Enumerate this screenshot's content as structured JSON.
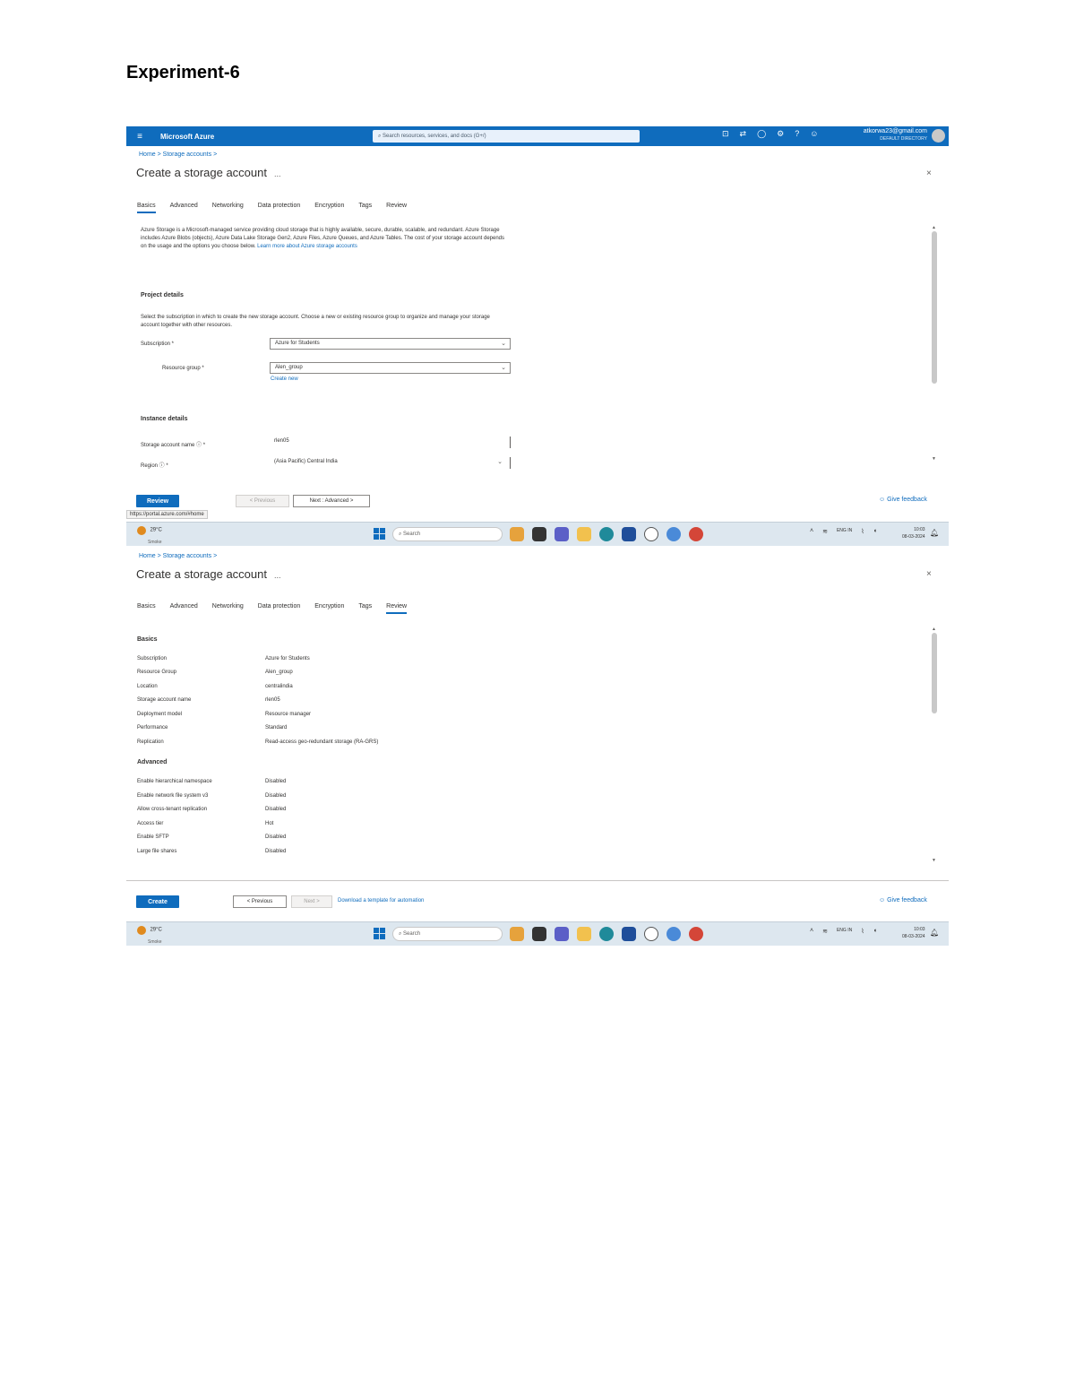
{
  "doc": {
    "title": "Experiment-6"
  },
  "azure": {
    "brand": "Microsoft Azure",
    "menu_icon": "hamburger-icon",
    "search_placeholder": "Search resources, services, and docs (G+/)",
    "user_email": "atkorwa23@gmail.com",
    "user_directory": "DEFAULT DIRECTORY"
  },
  "shot1": {
    "breadcrumb": "Home > Storage accounts >",
    "title": "Create a storage account",
    "more": "...",
    "close": "×",
    "tabs": [
      "Basics",
      "Advanced",
      "Networking",
      "Data protection",
      "Encryption",
      "Tags",
      "Review"
    ],
    "active_tab": "Basics",
    "intro_text": "Azure Storage is a Microsoft-managed service providing cloud storage that is highly available, secure, durable, scalable, and redundant. Azure Storage includes Azure Blobs (objects), Azure Data Lake Storage Gen2, Azure Files, Azure Queues, and Azure Tables. The cost of your storage account depends on the usage and the options you choose below.",
    "intro_link": "Learn more about Azure storage accounts",
    "project_heading": "Project details",
    "project_desc": "Select the subscription in which to create the new storage account. Choose a new or existing resource group to organize and manage your storage account together with other resources.",
    "subscription_label": "Subscription *",
    "subscription_value": "Azure for Students",
    "rg_label": "Resource group *",
    "rg_value": "Alen_group",
    "create_new": "Create new",
    "instance_heading": "Instance details",
    "sa_name_label": "Storage account name ⓘ *",
    "sa_name_value": "rlen05",
    "region_label": "Region ⓘ *",
    "region_value": "(Asia Pacific) Central India",
    "review_btn": "Review",
    "previous_btn": "< Previous",
    "next_btn": "Next : Advanced >",
    "feedback": "Give feedback",
    "status_url": "https://portal.azure.com/#home"
  },
  "shot2": {
    "breadcrumb": "Home > Storage accounts >",
    "title": "Create a storage account",
    "more": "...",
    "close": "×",
    "tabs": [
      "Basics",
      "Advanced",
      "Networking",
      "Data protection",
      "Encryption",
      "Tags",
      "Review"
    ],
    "active_tab": "Review",
    "basics_heading": "Basics",
    "basics": [
      {
        "label": "Subscription",
        "value": "Azure for Students"
      },
      {
        "label": "Resource Group",
        "value": "Alen_group"
      },
      {
        "label": "Location",
        "value": "centralindia"
      },
      {
        "label": "Storage account name",
        "value": "rlen05"
      },
      {
        "label": "Deployment model",
        "value": "Resource manager"
      },
      {
        "label": "Performance",
        "value": "Standard"
      },
      {
        "label": "Replication",
        "value": "Read-access geo-redundant storage (RA-GRS)"
      }
    ],
    "advanced_heading": "Advanced",
    "advanced": [
      {
        "label": "Enable hierarchical namespace",
        "value": "Disabled"
      },
      {
        "label": "Enable network file system v3",
        "value": "Disabled"
      },
      {
        "label": "Allow cross-tenant replication",
        "value": "Disabled"
      },
      {
        "label": "Access tier",
        "value": "Hot"
      },
      {
        "label": "Enable SFTP",
        "value": "Disabled"
      },
      {
        "label": "Large file shares",
        "value": "Disabled"
      }
    ],
    "create_btn": "Create",
    "previous_btn": "< Previous",
    "next_btn": "Next >",
    "download_link": "Download a template for automation",
    "feedback": "Give feedback"
  },
  "taskbar": {
    "temp": "29°C",
    "condition": "Smoke",
    "search_placeholder": "Search",
    "time": "10:03",
    "date": "08-03-2024",
    "lang": "ENG IN",
    "apps": [
      "copilot-icon",
      "file-explorer-icon",
      "teams-icon",
      "folder-icon",
      "edge-icon",
      "store-icon",
      "xbox-icon",
      "chrome-icon",
      "chrome-profile-icon"
    ]
  },
  "colors": {
    "azure_blue": "#0f6cbd",
    "taskbar": "#dde7ef"
  }
}
